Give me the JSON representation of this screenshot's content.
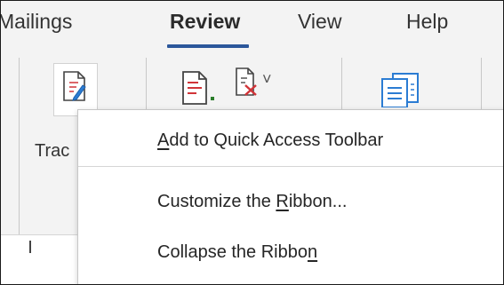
{
  "tabs": [
    {
      "label": "Mailings",
      "active": false
    },
    {
      "label": "Review",
      "active": true
    },
    {
      "label": "View",
      "active": false
    },
    {
      "label": "Help",
      "active": false
    }
  ],
  "ribbon": {
    "track_label_partial": "Trac",
    "icons": [
      "track-changes-icon",
      "accept-change-icon",
      "reject-change-icon",
      "compare-icon"
    ],
    "dropdown_glyph": "˅"
  },
  "context_menu": {
    "items": [
      {
        "pre": "",
        "access_key": "A",
        "post": "dd to Quick Access Toolbar"
      },
      {
        "pre": "Customize the ",
        "access_key": "R",
        "post": "ibbon..."
      },
      {
        "pre": "Collapse the Ribbo",
        "access_key": "n",
        "post": ""
      }
    ]
  },
  "colors": {
    "accent_underline": "#2b579a",
    "ribbon_bg": "#f3f3f3",
    "menu_bg": "#ffffff",
    "reject_red": "#d13438"
  }
}
